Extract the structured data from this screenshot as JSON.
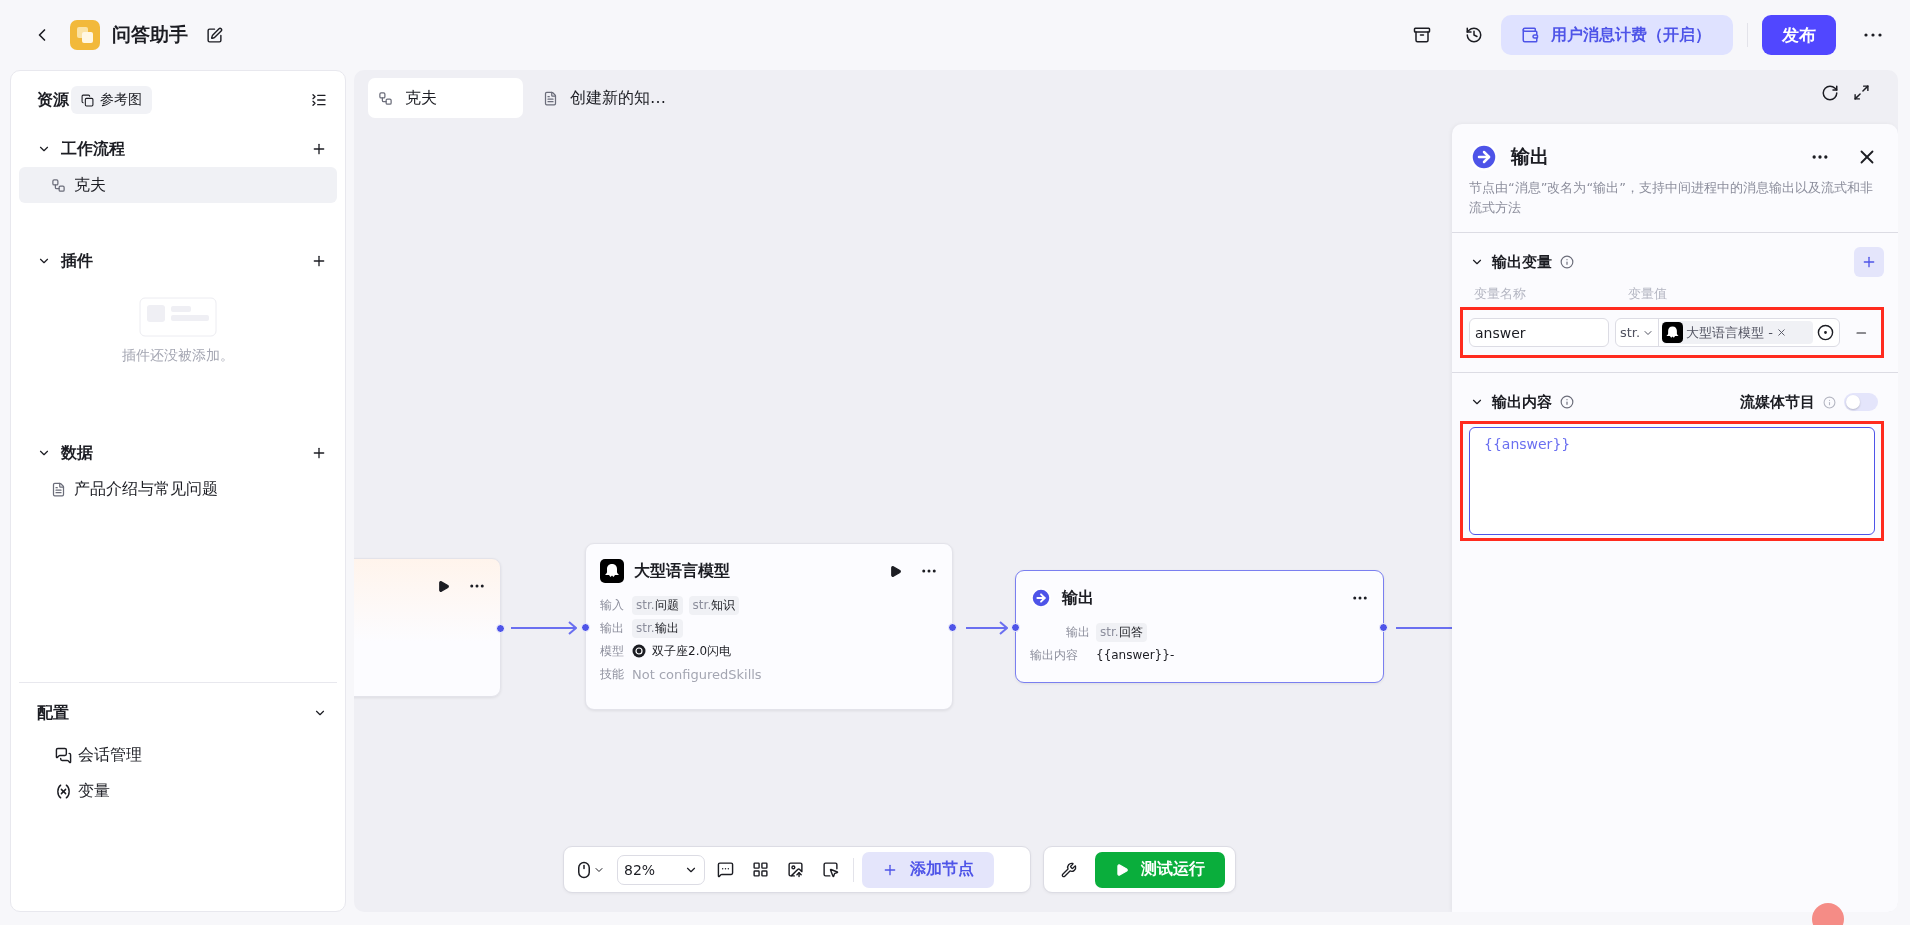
{
  "header": {
    "title": "问答助手",
    "billing_button": "用户消息计费（开启）",
    "publish_button": "发布"
  },
  "sidebar": {
    "title": "资源",
    "reference_button": "参考图",
    "sections": [
      {
        "title": "工作流程",
        "expanded": true,
        "items": [
          {
            "label": "克夫",
            "selected": true,
            "kind": "workflow"
          }
        ]
      },
      {
        "title": "插件",
        "expanded": true,
        "empty_text": "插件还没被添加。"
      },
      {
        "title": "数据",
        "expanded": true,
        "items": [
          {
            "label": "产品介绍与常见问题",
            "selected": false,
            "kind": "document"
          }
        ]
      }
    ],
    "config": {
      "title": "配置",
      "expanded": true,
      "items": [
        {
          "label": "会话管理",
          "kind": "chat"
        },
        {
          "label": "变量",
          "kind": "variable"
        }
      ]
    }
  },
  "canvas_tabs": [
    {
      "label": "克夫",
      "selected": true,
      "kind": "workflow"
    },
    {
      "label": "创建新的知…",
      "selected": false,
      "kind": "document"
    }
  ],
  "nodes": [
    {
      "kind": "clipped",
      "selected": false,
      "runnable": true
    },
    {
      "kind": "llm",
      "title": "大型语言模型",
      "selected": false,
      "runnable": true,
      "rows": [
        {
          "label": "输入",
          "kind": "tags",
          "tags": [
            {
              "type": "str.",
              "name": "问题"
            },
            {
              "type": "str.",
              "name": "知识"
            }
          ]
        },
        {
          "label": "输出",
          "kind": "tags",
          "tags": [
            {
              "type": "str.",
              "name": "输出"
            }
          ]
        },
        {
          "label": "模型",
          "kind": "model",
          "text": "双子座2.0闪电"
        },
        {
          "label": "技能",
          "kind": "muted",
          "text": "Not configuredSkills"
        }
      ]
    },
    {
      "kind": "output",
      "title": "输出",
      "selected": true,
      "runnable": false,
      "rows": [
        {
          "label": "输出",
          "kind": "tags",
          "tags": [
            {
              "type": "str.",
              "name": "回答"
            }
          ]
        },
        {
          "label": "输出内容",
          "kind": "text",
          "text": "{{answer}}-"
        }
      ]
    }
  ],
  "panel": {
    "title": "输出",
    "description": "节点由“消息”改名为“输出”，支持中间进程中的消息输出以及流式和非流式方法",
    "variables": {
      "title": "输出变量",
      "expanded": true,
      "name_header": "变量名称",
      "value_header": "变量值",
      "rows": [
        {
          "name": "answer",
          "type": "str.",
          "source": "大型语言模型 -",
          "highlighted": true
        }
      ]
    },
    "content": {
      "title": "输出内容",
      "expanded": true,
      "stream_label": "流媒体节目",
      "stream_on": false,
      "value": "{{answer}}",
      "highlighted": true
    }
  },
  "toolbar": {
    "zoom": "82%",
    "add_node": "添加节点",
    "test_run": "测试运行"
  }
}
